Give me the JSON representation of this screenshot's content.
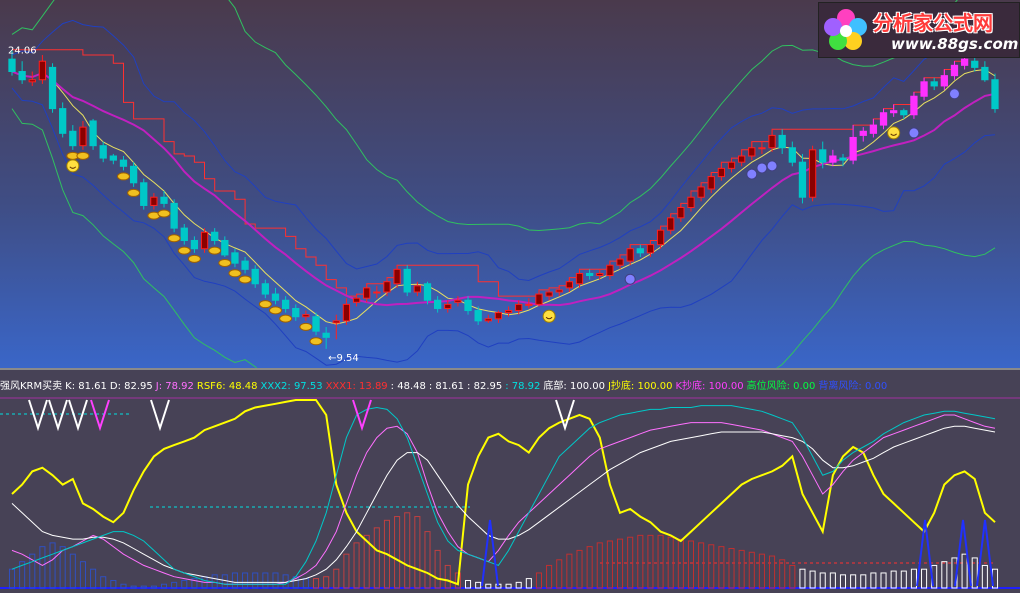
{
  "logo": {
    "title": "分析家公式网",
    "url": "www.88gs.com"
  },
  "main_chart": {
    "high_label": "24.06",
    "low_label": "←9.54",
    "colors": {
      "bull": "#ff2020",
      "bull_fill": "#8b0000",
      "bear": "#00c8c8",
      "bear_fill": "#00c8c8",
      "pink_bull": "#ff30ff",
      "white_bull": "#ffffff",
      "ma_magenta": "#c020c0",
      "ma_yellow": "#e8e060",
      "band_green": "#30c060",
      "band_blue": "#2040c0",
      "stair_red": "#ff3030"
    }
  },
  "chart_data": [
    {
      "type": "candlestick",
      "title": "",
      "x": [
        1,
        2,
        3,
        4,
        5,
        6,
        7,
        8,
        9,
        10,
        11,
        12,
        13,
        14,
        15,
        16,
        17,
        18,
        19,
        20,
        21,
        22,
        23,
        24,
        25,
        26,
        27,
        28,
        29,
        30,
        31,
        32,
        33,
        34,
        35,
        36,
        37,
        38,
        39,
        40,
        41,
        42,
        43,
        44,
        45,
        46,
        47,
        48,
        49,
        50,
        51,
        52,
        53,
        54,
        55,
        56,
        57,
        58,
        59,
        60,
        61,
        62,
        63,
        64,
        65,
        66,
        67,
        68,
        69,
        70,
        71,
        72,
        73,
        74,
        75,
        76,
        77,
        78,
        79,
        80,
        81,
        82,
        83,
        84,
        85,
        86,
        87,
        88,
        89,
        90,
        91,
        92,
        93,
        94,
        95,
        96,
        97,
        98
      ],
      "open": [
        23.6,
        23.0,
        22.5,
        22.6,
        23.2,
        21.2,
        20.1,
        19.4,
        20.6,
        19.4,
        18.9,
        18.7,
        18.4,
        17.6,
        16.5,
        16.9,
        16.6,
        15.4,
        14.8,
        14.4,
        15.2,
        14.8,
        14.2,
        13.8,
        13.4,
        12.7,
        12.2,
        11.9,
        11.5,
        11.1,
        11.1,
        10.3,
        10.8,
        10.9,
        11.8,
        12.0,
        12.3,
        12.3,
        12.7,
        13.4,
        12.3,
        12.7,
        11.9,
        11.5,
        11.8,
        11.9,
        11.4,
        10.9,
        11.0,
        11.3,
        11.4,
        11.7,
        11.7,
        12.1,
        12.3,
        12.5,
        12.7,
        13.2,
        13.1,
        13.1,
        13.6,
        13.8,
        14.4,
        14.2,
        14.6,
        15.3,
        15.9,
        16.4,
        16.9,
        17.3,
        17.9,
        18.3,
        18.6,
        18.9,
        19.3,
        19.3,
        19.9,
        19.3,
        18.6,
        16.9,
        19.2,
        18.6,
        18.8,
        18.7,
        19.9,
        20.0,
        20.4,
        21.0,
        21.1,
        20.9,
        21.8,
        22.5,
        22.3,
        22.8,
        23.3,
        23.5,
        23.2,
        22.6
      ],
      "close": [
        23.0,
        22.6,
        22.6,
        23.5,
        21.2,
        20.0,
        19.4,
        20.3,
        19.4,
        18.8,
        18.7,
        18.4,
        17.6,
        16.5,
        16.9,
        16.6,
        15.4,
        14.8,
        14.4,
        15.2,
        14.8,
        14.1,
        13.7,
        13.4,
        12.7,
        12.2,
        11.9,
        11.5,
        11.1,
        11.2,
        10.4,
        10.1,
        10.9,
        11.7,
        12.0,
        12.5,
        12.3,
        12.8,
        13.4,
        12.3,
        12.6,
        11.9,
        11.5,
        11.7,
        11.9,
        11.4,
        10.9,
        11.0,
        11.3,
        11.4,
        11.7,
        11.7,
        12.2,
        12.3,
        12.4,
        12.8,
        13.2,
        13.1,
        13.2,
        13.6,
        13.9,
        14.4,
        14.2,
        14.6,
        15.3,
        15.9,
        16.4,
        16.9,
        17.4,
        17.9,
        18.3,
        18.6,
        18.9,
        19.3,
        19.3,
        19.9,
        19.3,
        18.6,
        16.9,
        19.2,
        18.6,
        18.9,
        18.7,
        19.8,
        20.1,
        20.4,
        21.0,
        21.1,
        20.9,
        21.8,
        22.5,
        22.3,
        22.8,
        23.3,
        23.6,
        23.2,
        22.6,
        21.2
      ],
      "high": [
        24.06,
        23.5,
        23.0,
        23.8,
        23.4,
        21.5,
        20.4,
        20.6,
        20.7,
        19.6,
        19.0,
        18.9,
        18.6,
        17.8,
        17.1,
        17.2,
        16.8,
        15.6,
        15.0,
        15.4,
        15.4,
        15.0,
        14.4,
        14.0,
        13.6,
        12.9,
        12.5,
        12.1,
        11.7,
        11.4,
        11.3,
        10.6,
        11.2,
        12.0,
        12.2,
        12.7,
        12.6,
        13.0,
        13.6,
        13.6,
        12.8,
        12.8,
        12.1,
        11.9,
        12.1,
        12.1,
        11.6,
        11.2,
        11.4,
        11.6,
        11.9,
        12.0,
        12.4,
        12.5,
        12.6,
        13.0,
        13.4,
        13.4,
        13.4,
        13.8,
        14.1,
        14.6,
        14.6,
        14.8,
        15.5,
        16.1,
        16.6,
        17.2,
        17.6,
        18.1,
        18.6,
        18.8,
        19.2,
        19.6,
        19.6,
        20.2,
        20.2,
        19.6,
        19.0,
        19.4,
        19.6,
        19.2,
        19.0,
        20.4,
        20.3,
        20.7,
        21.2,
        21.4,
        21.2,
        22.0,
        22.7,
        22.7,
        23.1,
        23.5,
        23.8,
        23.8,
        23.5,
        22.9
      ],
      "low": [
        22.8,
        22.4,
        22.3,
        22.4,
        21.0,
        19.8,
        19.2,
        19.2,
        19.2,
        18.6,
        18.5,
        18.2,
        17.4,
        16.3,
        16.3,
        16.4,
        15.2,
        14.6,
        14.2,
        14.2,
        14.6,
        14.0,
        13.5,
        13.2,
        12.5,
        12.0,
        11.7,
        11.3,
        10.9,
        10.9,
        10.2,
        9.54,
        10.0,
        10.7,
        11.6,
        11.8,
        12.0,
        12.1,
        12.5,
        12.1,
        12.1,
        11.7,
        11.3,
        11.3,
        11.6,
        11.2,
        10.7,
        10.8,
        10.8,
        11.1,
        11.2,
        11.5,
        11.6,
        11.9,
        12.1,
        12.3,
        12.5,
        12.9,
        12.9,
        12.9,
        13.4,
        13.6,
        14.0,
        14.0,
        14.4,
        15.1,
        15.7,
        16.2,
        16.7,
        17.1,
        17.7,
        18.1,
        18.4,
        18.7,
        19.0,
        19.1,
        19.0,
        18.4,
        16.6,
        16.7,
        18.3,
        18.4,
        18.4,
        18.5,
        19.6,
        19.8,
        20.2,
        20.8,
        20.7,
        20.7,
        21.6,
        22.1,
        22.1,
        22.6,
        23.1,
        23.0,
        22.5,
        21.0
      ],
      "ylim": [
        9.0,
        25.5
      ]
    },
    {
      "type": "line",
      "title": "",
      "legend": [
        {
          "label": "强风KRM买卖",
          "color": "#ffffff"
        },
        {
          "label": "K: 81.61",
          "color": "#ffffff"
        },
        {
          "label": "D: 82.95",
          "color": "#ffffff"
        },
        {
          "label": "J: 78.92",
          "color": "#ff70ff"
        },
        {
          "label": "RSF6: 48.48",
          "color": "#ffff00"
        },
        {
          "label": "XXX2: 97.53",
          "color": "#00e0e0"
        },
        {
          "label": "XXX1: 13.89",
          "color": "#ff3030"
        },
        {
          "label": ": 48.48",
          "color": "#ffffff"
        },
        {
          "label": ": 81.61",
          "color": "#ffffff"
        },
        {
          "label": ": 82.95",
          "color": "#ffffff"
        },
        {
          "label": ": 78.92",
          "color": "#00e0e0"
        },
        {
          "label": "底部: 100.00",
          "color": "#ffffff"
        },
        {
          "label": "J抄底: 100.00",
          "color": "#ffff00"
        },
        {
          "label": "K抄底: 100.00",
          "color": "#ff40ff"
        },
        {
          "label": "高位风险: 0.00",
          "color": "#00ff40"
        },
        {
          "label": "背离风险: 0.00",
          "color": "#3050ff"
        }
      ],
      "ylim": [
        0,
        100
      ],
      "series": [
        {
          "name": "RSF6",
          "color": "#ffff00",
          "values": [
            50,
            55,
            62,
            64,
            60,
            55,
            58,
            45,
            42,
            38,
            35,
            40,
            52,
            62,
            70,
            74,
            76,
            78,
            80,
            84,
            86,
            88,
            90,
            94,
            96,
            97,
            98,
            99,
            100,
            100,
            100,
            92,
            55,
            40,
            30,
            25,
            20,
            18,
            15,
            12,
            10,
            8,
            5,
            4,
            2,
            55,
            70,
            80,
            82,
            78,
            76,
            72,
            80,
            85,
            88,
            90,
            92,
            90,
            80,
            55,
            40,
            42,
            38,
            35,
            30,
            28,
            25,
            30,
            35,
            40,
            45,
            50,
            55,
            58,
            60,
            62,
            65,
            70,
            50,
            40,
            30,
            60,
            70,
            75,
            72,
            60,
            50,
            45,
            40,
            35,
            30,
            40,
            55,
            60,
            62,
            58,
            40,
            35
          ]
        },
        {
          "name": "K",
          "color": "#ff70ff",
          "values": [
            20,
            18,
            15,
            12,
            15,
            20,
            22,
            25,
            28,
            26,
            22,
            18,
            15,
            12,
            10,
            8,
            6,
            5,
            4,
            3,
            3,
            2,
            2,
            2,
            2,
            2,
            2,
            3,
            5,
            8,
            12,
            20,
            30,
            45,
            60,
            72,
            80,
            85,
            86,
            82,
            72,
            55,
            40,
            30,
            22,
            18,
            16,
            14,
            20,
            28,
            35,
            40,
            45,
            50,
            55,
            60,
            65,
            70,
            74,
            76,
            78,
            80,
            82,
            84,
            85,
            86,
            87,
            88,
            88,
            88,
            88,
            87,
            86,
            85,
            84,
            82,
            80,
            78,
            70,
            60,
            50,
            55,
            62,
            68,
            72,
            76,
            80,
            82,
            84,
            86,
            88,
            90,
            92,
            92,
            90,
            88,
            86,
            85
          ]
        },
        {
          "name": "D",
          "color": "#ffffff",
          "values": [
            45,
            40,
            35,
            30,
            28,
            27,
            26,
            26,
            27,
            27,
            26,
            24,
            21,
            18,
            15,
            12,
            10,
            8,
            7,
            6,
            5,
            4,
            3,
            3,
            3,
            3,
            3,
            3,
            4,
            5,
            7,
            10,
            15,
            22,
            30,
            40,
            50,
            60,
            68,
            72,
            72,
            68,
            60,
            52,
            44,
            38,
            33,
            28,
            26,
            26,
            28,
            31,
            35,
            39,
            43,
            47,
            51,
            55,
            59,
            63,
            66,
            69,
            72,
            74,
            76,
            78,
            79,
            80,
            81,
            82,
            83,
            83,
            83,
            83,
            83,
            82,
            81,
            80,
            78,
            74,
            68,
            64,
            64,
            65,
            67,
            69,
            72,
            75,
            77,
            79,
            81,
            83,
            85,
            86,
            86,
            85,
            84,
            83
          ]
        },
        {
          "name": "J",
          "color": "#00c8c8",
          "values": [
            10,
            12,
            14,
            16,
            18,
            20,
            22,
            24,
            26,
            28,
            30,
            30,
            28,
            25,
            20,
            15,
            10,
            8,
            6,
            4,
            3,
            2,
            2,
            2,
            2,
            2,
            2,
            2,
            6,
            14,
            25,
            40,
            60,
            80,
            92,
            95,
            96,
            95,
            90,
            80,
            65,
            50,
            35,
            25,
            20,
            18,
            16,
            14,
            12,
            20,
            30,
            40,
            50,
            60,
            70,
            75,
            80,
            85,
            88,
            90,
            92,
            93,
            94,
            95,
            95,
            96,
            96,
            96,
            97,
            97,
            97,
            97,
            96,
            95,
            94,
            92,
            90,
            88,
            80,
            70,
            60,
            62,
            68,
            72,
            75,
            78,
            82,
            85,
            88,
            90,
            92,
            93,
            94,
            94,
            93,
            92,
            91,
            90
          ]
        }
      ],
      "histogram_values": [
        10,
        14,
        18,
        22,
        24,
        22,
        18,
        14,
        10,
        6,
        4,
        2,
        1,
        1,
        1,
        2,
        3,
        4,
        5,
        6,
        7,
        7,
        8,
        8,
        8,
        8,
        8,
        7,
        6,
        5,
        5,
        6,
        10,
        18,
        24,
        28,
        32,
        36,
        38,
        40,
        38,
        30,
        20,
        12,
        8,
        4,
        3,
        2,
        2,
        2,
        3,
        5,
        8,
        12,
        15,
        18,
        20,
        22,
        24,
        25,
        26,
        27,
        28,
        28,
        28,
        27,
        26,
        25,
        24,
        23,
        22,
        21,
        20,
        19,
        18,
        17,
        15,
        12,
        10,
        9,
        8,
        8,
        7,
        7,
        7,
        8,
        8,
        9,
        9,
        10,
        10,
        12,
        14,
        16,
        18,
        16,
        12,
        10
      ]
    }
  ]
}
